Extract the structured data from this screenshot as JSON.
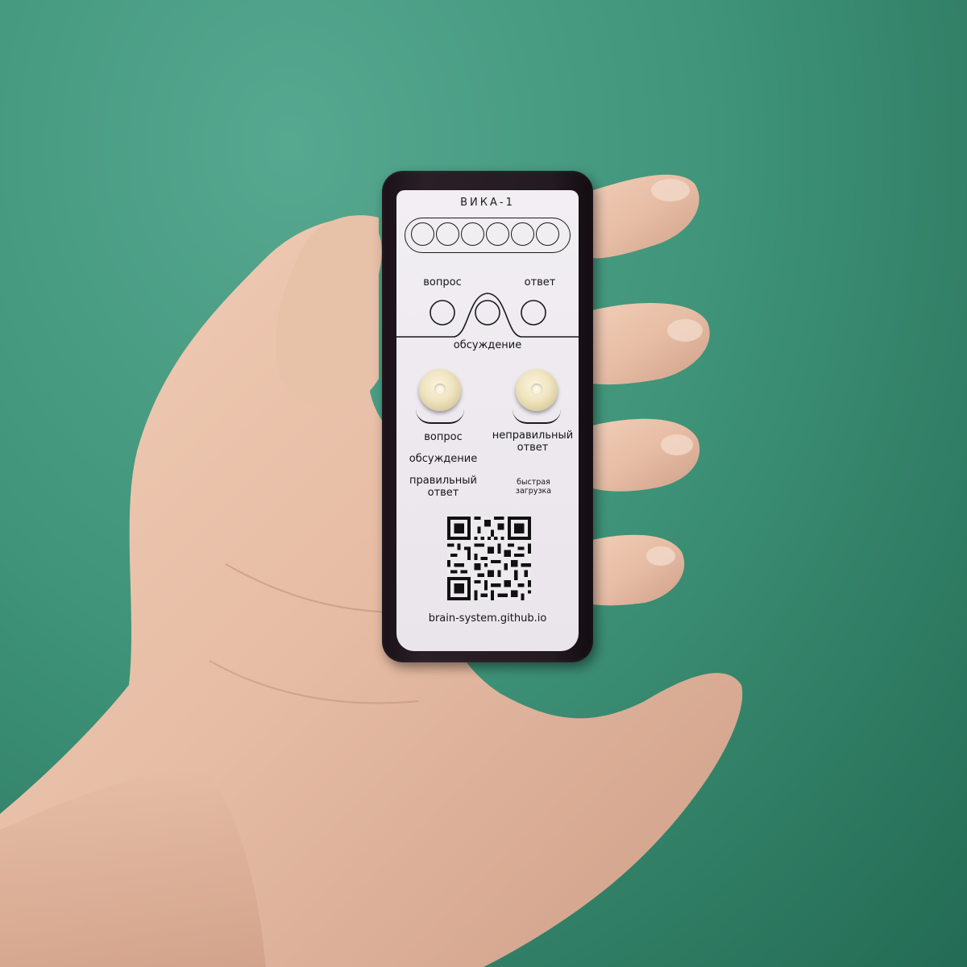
{
  "device": {
    "title": "ВИКА-1",
    "mode_left": "вопрос",
    "mode_right": "ответ",
    "mode_center": "обсуждение",
    "left_button_label_1": "вопрос",
    "left_button_label_2": "обсуждение",
    "left_button_label_3": "правильный\nответ",
    "right_button_label_1": "неправильный\nответ",
    "right_button_label_2": "быстрая\nзагрузка",
    "url": "brain-system.github.io",
    "led_count": 6
  },
  "colors": {
    "background": "#3f9479",
    "device_body": "#241a21",
    "label": "#eeebef",
    "button": "#efe4c0",
    "skin": "#e9c0a8"
  },
  "icons": [
    "qr-code-icon"
  ]
}
